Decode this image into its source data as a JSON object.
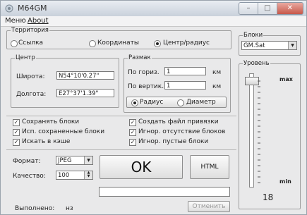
{
  "window": {
    "title": "M64GM"
  },
  "menu": {
    "items": [
      "Меню",
      "About"
    ]
  },
  "territory": {
    "legend": "Территория",
    "options": [
      "Ссылка",
      "Координаты",
      "Центр/радиус"
    ],
    "selected": "Центр/радиус"
  },
  "center": {
    "legend": "Центр",
    "lat_label": "Широта:",
    "lat_value": "N54°10'0.27\"",
    "lon_label": "Долгота:",
    "lon_value": "E27°37'1.39\""
  },
  "size": {
    "legend": "Размак",
    "horiz_label": "По гориз.",
    "horiz_value": "1",
    "horiz_unit": "км",
    "vert_label": "По вертик.",
    "vert_value": "1",
    "vert_unit": "км",
    "modes": [
      "Радиус",
      "Диаметр"
    ],
    "selected_mode": "Радиус"
  },
  "options": {
    "save_blocks": "Сохранять блоки",
    "use_saved": "Исп. сохраненные блоки",
    "search_cache": "Искать в кэше",
    "create_binding": "Создать файл привязки",
    "ignore_missing": "Игнор. отсутствие блоков",
    "ignore_empty": "Игнор. пустые блоки"
  },
  "format": {
    "label": "Формат:",
    "value": "JPEG"
  },
  "quality": {
    "label": "Качество:",
    "value": "100"
  },
  "buttons": {
    "ok": "OK",
    "html": "HTML",
    "cancel": "Отменить"
  },
  "status": {
    "label": "Выполнено:",
    "value": "нз"
  },
  "blocks": {
    "legend": "Блоки",
    "value": "GM.Sat"
  },
  "level": {
    "legend": "Уровень",
    "max": "max",
    "min": "min",
    "value": "18"
  }
}
